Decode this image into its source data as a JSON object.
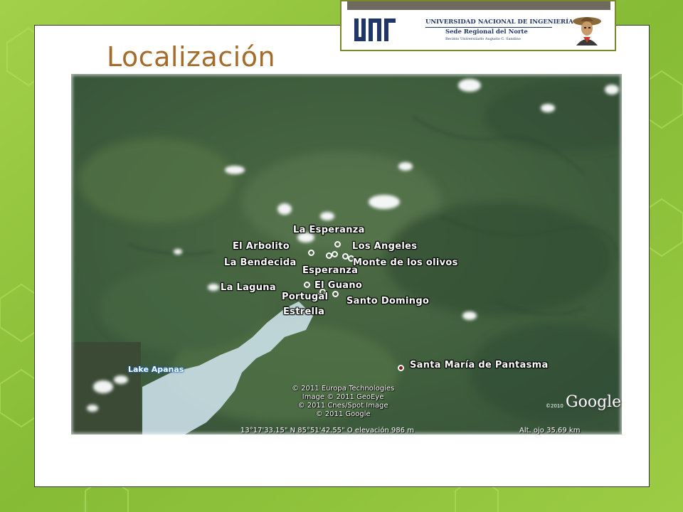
{
  "slide": {
    "title": "Localización"
  },
  "logo": {
    "university": "UNIVERSIDAD NACIONAL DE INGENIERÍA",
    "sede": "Sede Regional del Norte",
    "recinto": "Recinto Universitario Augusto C. Sandino",
    "acronym": "UNI"
  },
  "map": {
    "lake_label": "Lake Apanas",
    "places": [
      {
        "name": "La Esperanza"
      },
      {
        "name": "El Arbolito"
      },
      {
        "name": "Los Angeles"
      },
      {
        "name": "La Bendecida"
      },
      {
        "name": "Monte de los olivos"
      },
      {
        "name": "Esperanza"
      },
      {
        "name": "La Laguna"
      },
      {
        "name": "El Guano"
      },
      {
        "name": "Portugal"
      },
      {
        "name": "Santo Domingo"
      },
      {
        "name": "Estrella"
      },
      {
        "name": "Santa María de Pantasma"
      }
    ],
    "copyright": [
      "© 2011 Europa Technologies",
      "Image © 2011 GeoEye",
      "© 2011 Cnes/Spot Image",
      "© 2011 Google"
    ],
    "status_coords": "13°17'33.15\" N  85°51'42.55\" O  elevación  986 m",
    "status_altitude": "Alt. ojo   35.69 km",
    "google_logo": "Google",
    "google_year": "©2010"
  },
  "colors": {
    "title": "#a46b2a",
    "background": "#8fc23e",
    "uni_blue": "#1e3766"
  }
}
